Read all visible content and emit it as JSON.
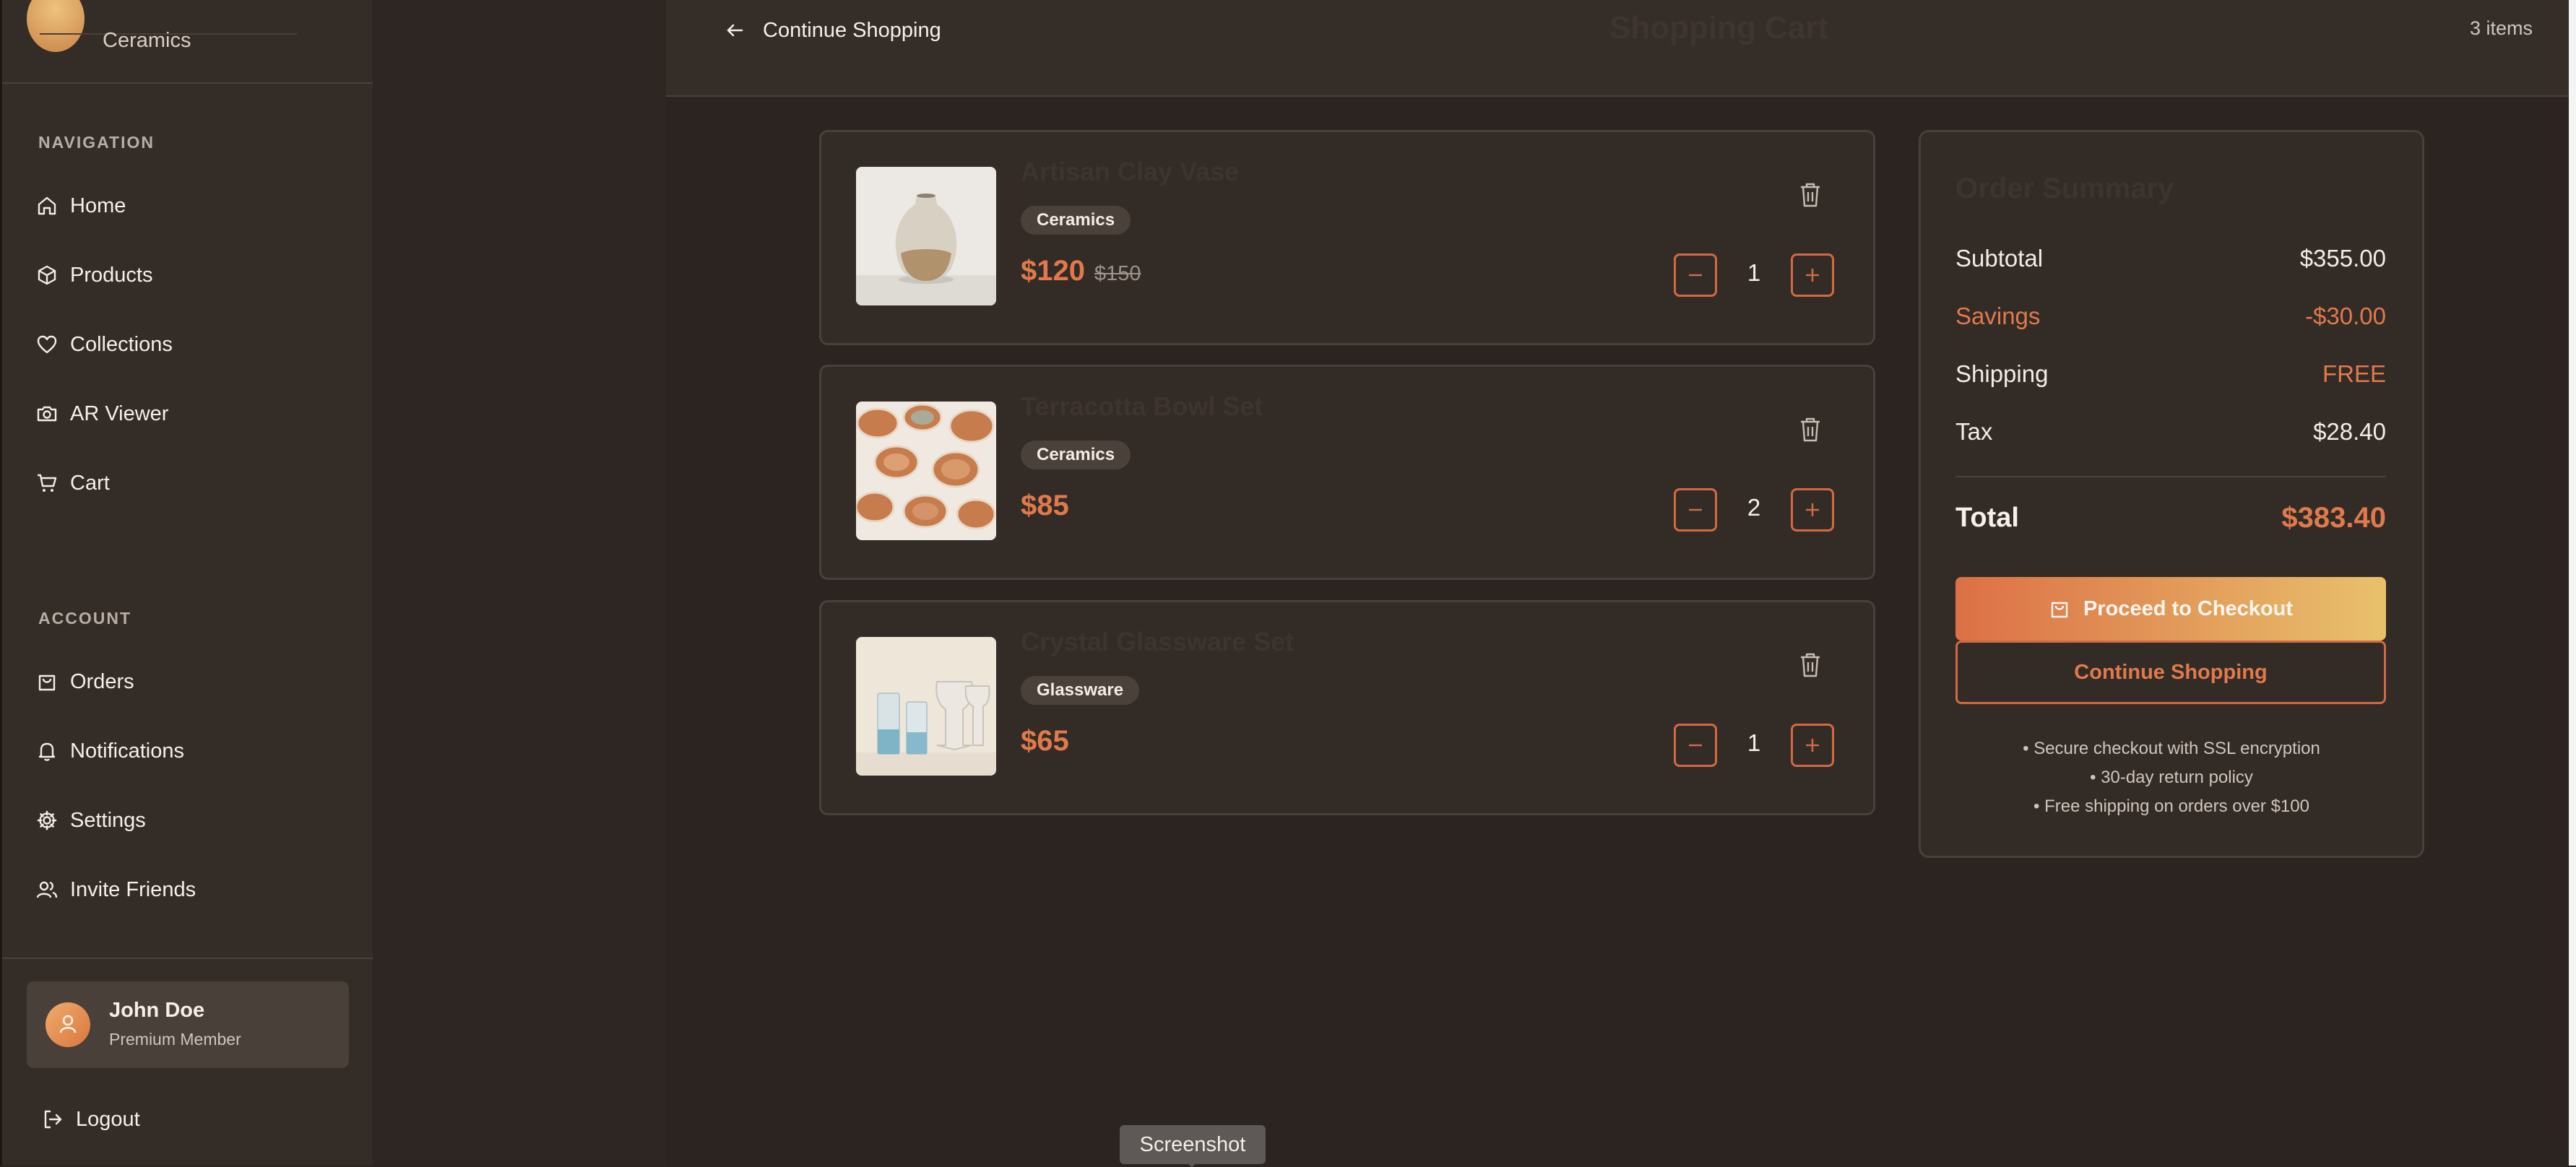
{
  "brand": {
    "name": "Ceramics"
  },
  "sidebar": {
    "nav_title": "NAVIGATION",
    "nav": [
      {
        "label": "Home",
        "icon": "home-icon"
      },
      {
        "label": "Products",
        "icon": "box-icon"
      },
      {
        "label": "Collections",
        "icon": "heart-icon"
      },
      {
        "label": "AR Viewer",
        "icon": "camera-icon"
      },
      {
        "label": "Cart",
        "icon": "cart-icon"
      }
    ],
    "account_title": "ACCOUNT",
    "account": [
      {
        "label": "Orders",
        "icon": "bag-icon"
      },
      {
        "label": "Notifications",
        "icon": "bell-icon"
      },
      {
        "label": "Settings",
        "icon": "gear-icon"
      },
      {
        "label": "Invite Friends",
        "icon": "users-icon"
      }
    ],
    "user": {
      "name": "John Doe",
      "role": "Premium Member"
    },
    "logout": "Logout"
  },
  "header": {
    "back_label": "Continue Shopping",
    "title": "Shopping Cart",
    "item_count": "3 items"
  },
  "cart": {
    "items": [
      {
        "name": "Artisan Clay Vase",
        "category": "Ceramics",
        "price": "$120",
        "old_price": "$150",
        "quantity": "1"
      },
      {
        "name": "Terracotta Bowl Set",
        "category": "Ceramics",
        "price": "$85",
        "old_price": "",
        "quantity": "2"
      },
      {
        "name": "Crystal Glassware Set",
        "category": "Glassware",
        "price": "$65",
        "old_price": "",
        "quantity": "1"
      }
    ]
  },
  "summary": {
    "title": "Order Summary",
    "subtotal_label": "Subtotal",
    "subtotal": "$355.00",
    "savings_label": "Savings",
    "savings": "-$30.00",
    "shipping_label": "Shipping",
    "shipping": "FREE",
    "tax_label": "Tax",
    "tax": "$28.40",
    "total_label": "Total",
    "total": "$383.40",
    "checkout_label": "Proceed to Checkout",
    "continue_label": "Continue Shopping",
    "notes": [
      "• Secure checkout with SSL encryption",
      "• 30-day return policy",
      "• Free shipping on orders over $100"
    ]
  },
  "tooltip": "Screenshot",
  "colors": {
    "accent": "#e07a4d",
    "background": "#2b2420",
    "panel": "#332b26"
  }
}
